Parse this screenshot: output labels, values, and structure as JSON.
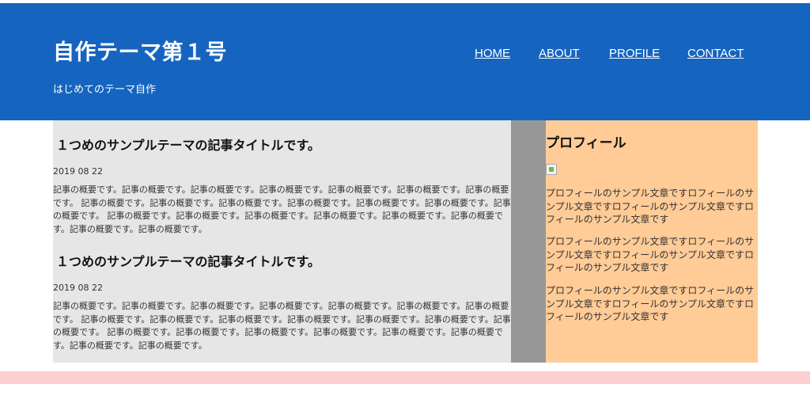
{
  "header": {
    "title": "自作テーマ第１号",
    "description": "はじめてのテーマ自作",
    "nav": [
      {
        "label": "HOME"
      },
      {
        "label": "ABOUT"
      },
      {
        "label": "PROFILE"
      },
      {
        "label": "CONTACT"
      }
    ]
  },
  "articles": [
    {
      "title": "１つめのサンプルテーマの記事タイトルです。",
      "date": "2019 08 22",
      "excerpt": "記事の概要です。記事の概要です。記事の概要です。記事の概要です。記事の概要です。記事の概要です。記事の概要です。 記事の概要です。記事の概要です。記事の概要です。記事の概要です。記事の概要です。記事の概要です。記事の概要です。 記事の概要です。記事の概要です。記事の概要です。記事の概要です。記事の概要です。記事の概要です。記事の概要です。記事の概要です。"
    },
    {
      "title": "１つめのサンプルテーマの記事タイトルです。",
      "date": "2019 08 22",
      "excerpt": "記事の概要です。記事の概要です。記事の概要です。記事の概要です。記事の概要です。記事の概要です。記事の概要です。 記事の概要です。記事の概要です。記事の概要です。記事の概要です。記事の概要です。記事の概要です。記事の概要です。 記事の概要です。記事の概要です。記事の概要です。記事の概要です。記事の概要です。記事の概要です。記事の概要です。記事の概要です。"
    }
  ],
  "sidebar": {
    "title": "プロフィール",
    "paragraphs": [
      "プロフィールのサンプル文章ですロフィールのサンプル文章ですロフィールのサンプル文章ですロフィールのサンプル文章です",
      "プロフィールのサンプル文章ですロフィールのサンプル文章ですロフィールのサンプル文章ですロフィールのサンプル文章です",
      "プロフィールのサンプル文章ですロフィールのサンプル文章ですロフィールのサンプル文章ですロフィールのサンプル文章です"
    ]
  },
  "colors": {
    "header_bg": "#1565c0",
    "main_bg": "#e6e6e6",
    "gutter_bg": "#979797",
    "sidebar_bg": "#ffcb97",
    "footer_band": "#ffcfcf"
  }
}
